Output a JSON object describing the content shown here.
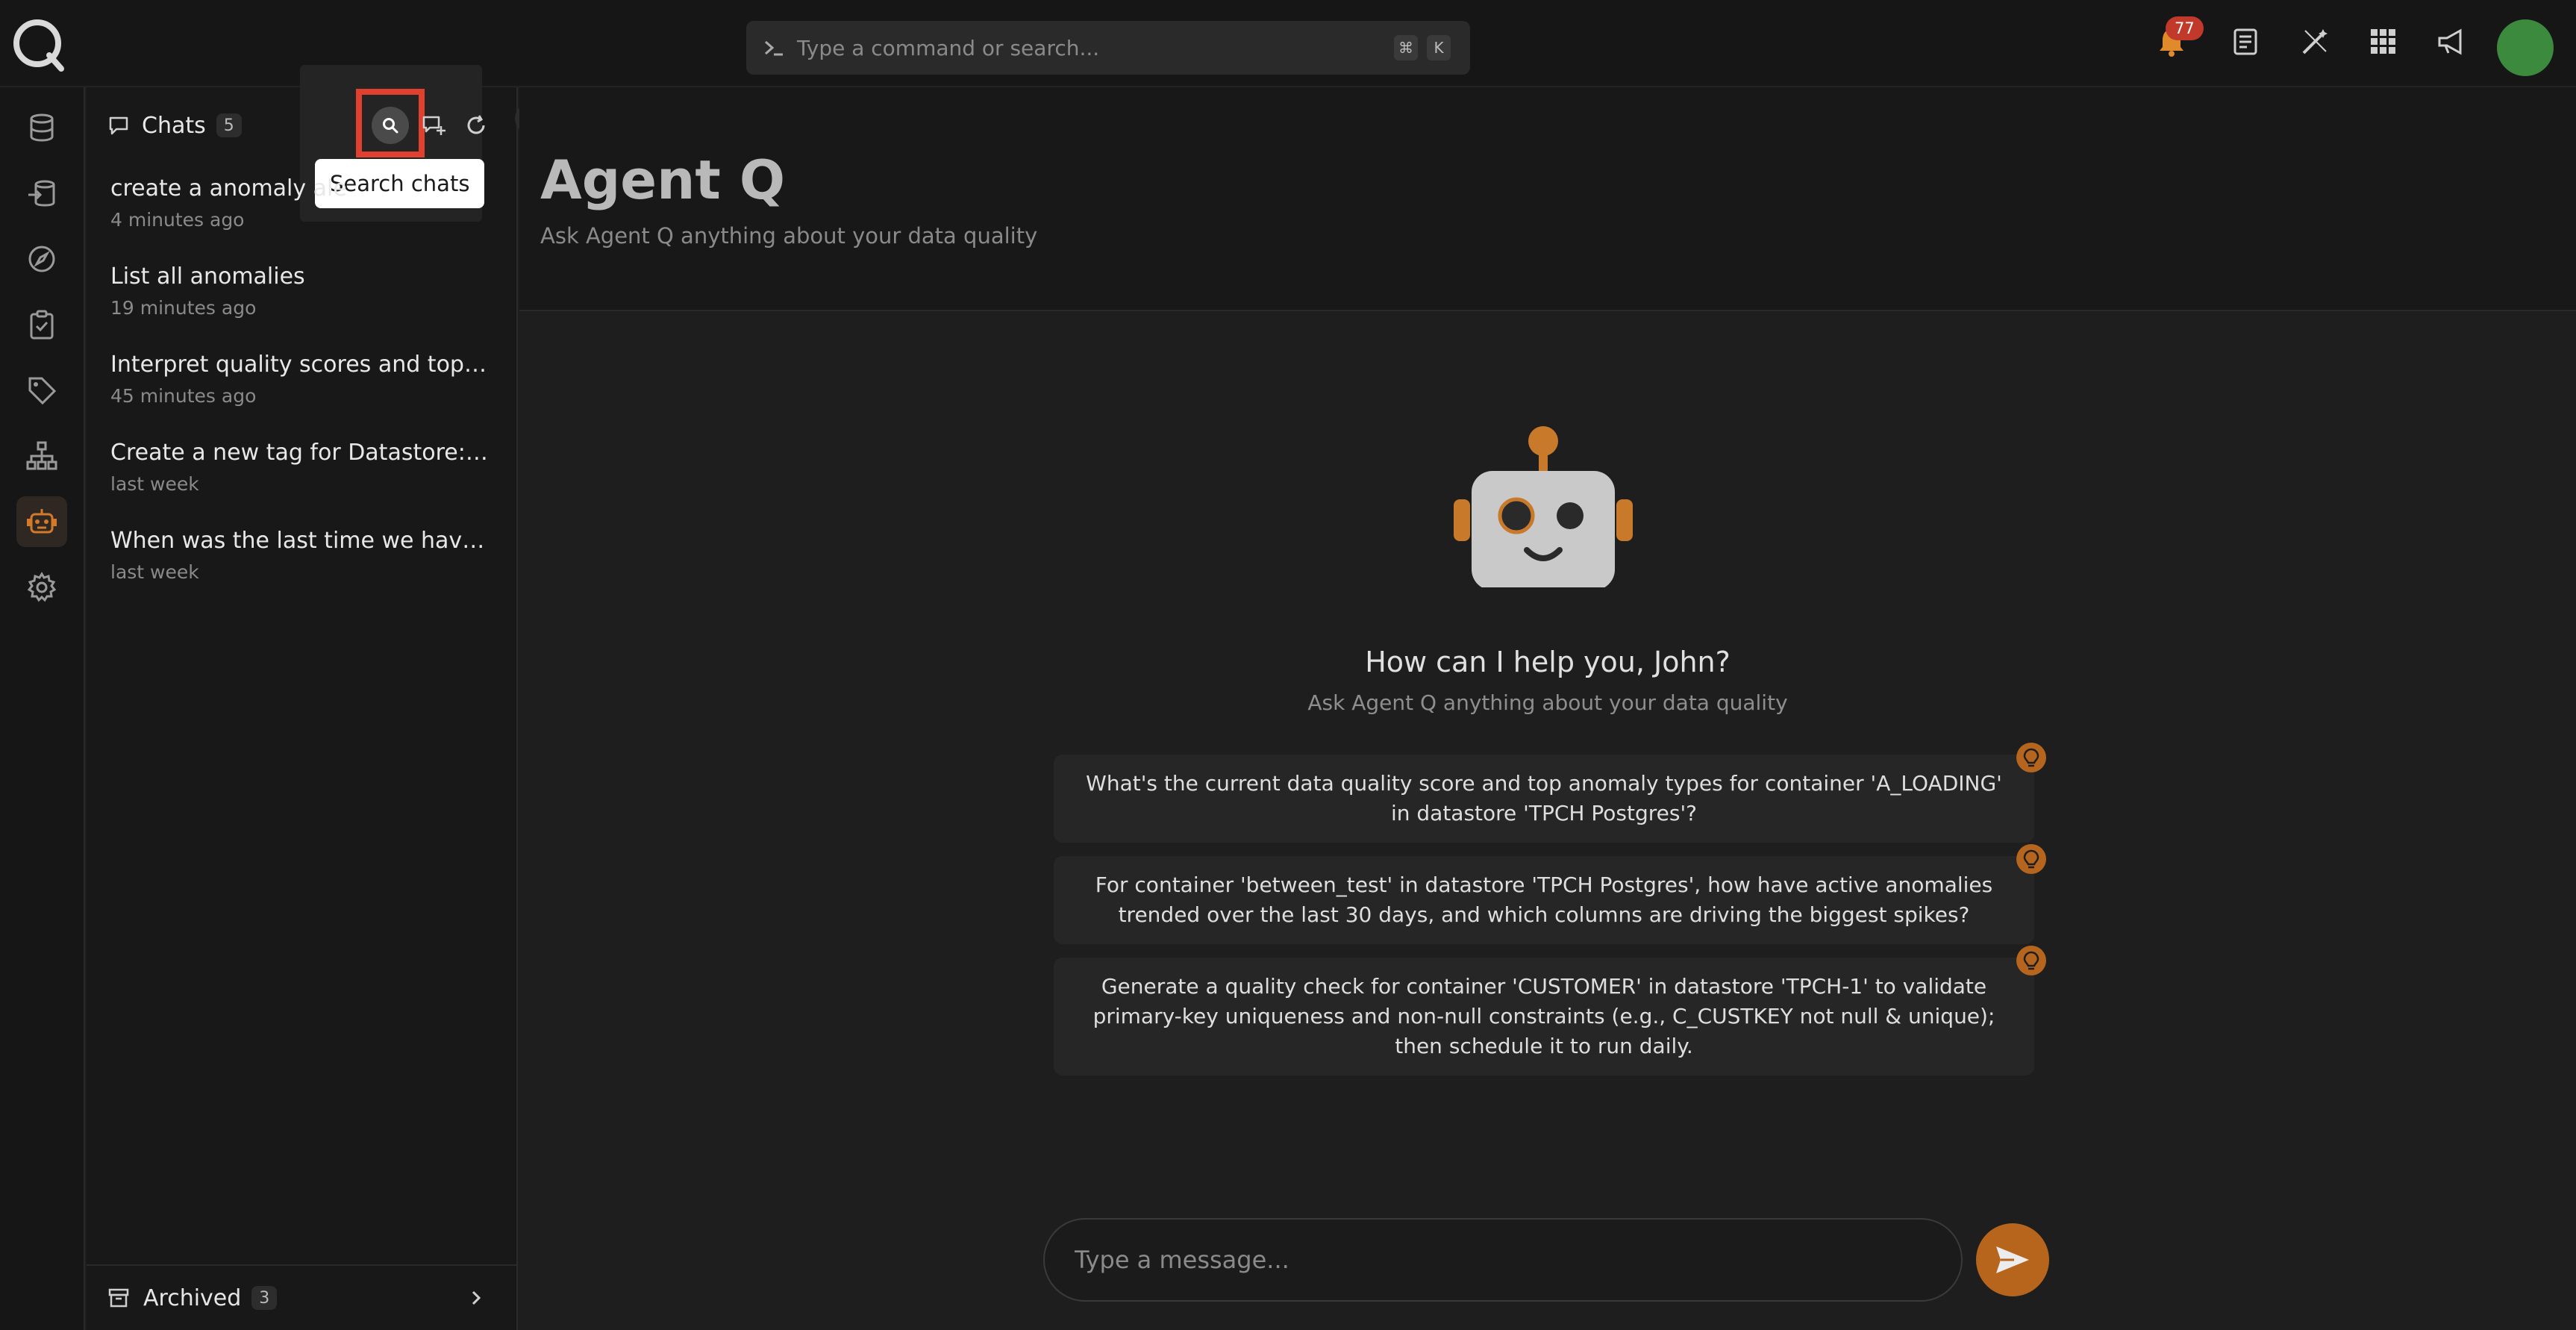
{
  "command_bar": {
    "placeholder": "Type a command or search...",
    "key_cmd": "⌘",
    "key_k": "K"
  },
  "notifications": {
    "count": "77"
  },
  "chats_panel": {
    "title": "Chats",
    "count": "5",
    "tooltip": "Search chats",
    "items": [
      {
        "title": "create a anomaly ale",
        "time": "4 minutes ago"
      },
      {
        "title": "List all anomalies",
        "time": "19 minutes ago"
      },
      {
        "title": "Interpret quality scores and top an...",
        "time": "45 minutes ago"
      },
      {
        "title": "Create a new tag for Datastore: An...",
        "time": "last week"
      },
      {
        "title": "When was the last time we have an ...",
        "time": "last week"
      }
    ],
    "archived": {
      "label": "Archived",
      "count": "3"
    }
  },
  "main": {
    "title": "Agent Q",
    "subtitle": "Ask Agent Q anything about your data quality",
    "greeting": "How can I help you, John?",
    "greeting_sub": "Ask Agent Q anything about your data quality",
    "suggestions": [
      "What's the current data quality score and top anomaly types for container 'A_LOADING' in datastore 'TPCH Postgres'?",
      "For container 'between_test' in datastore 'TPCH Postgres', how have active anomalies trended over the last 30 days, and which columns are driving the biggest spikes?",
      "Generate a quality check for container 'CUSTOMER' in datastore 'TPCH-1' to validate primary-key uniqueness and non-null constraints (e.g., C_CUSTKEY not null & unique); then schedule it to run daily."
    ],
    "composer_placeholder": "Type a message..."
  },
  "colors": {
    "accent": "#b7651d",
    "highlight": "#e0412f",
    "avatar": "#3b8a3d"
  },
  "icons": [
    "logo-icon",
    "database-icon",
    "source-icon",
    "compass-icon",
    "checklist-icon",
    "tag-icon",
    "hierarchy-icon",
    "robot-icon",
    "gear-icon",
    "bell-icon",
    "document-icon",
    "wand-icon",
    "grid-icon",
    "megaphone-icon",
    "chat-icon",
    "search-icon",
    "new-chat-icon",
    "refresh-icon",
    "archive-icon",
    "chevron-right-icon",
    "chevron-left-icon",
    "lightbulb-icon",
    "send-icon"
  ]
}
